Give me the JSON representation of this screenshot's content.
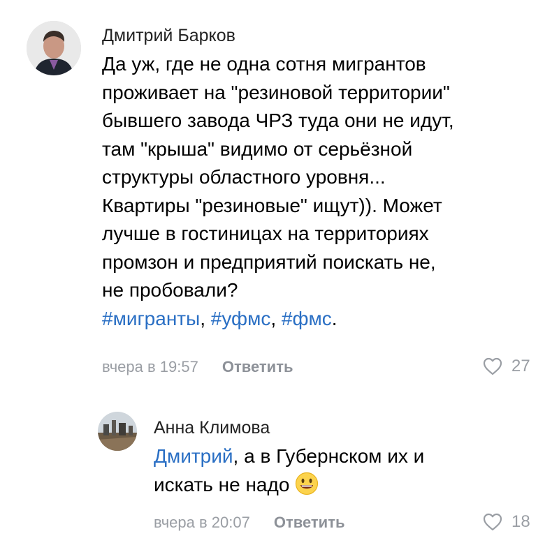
{
  "comments": [
    {
      "author": "Дмитрий Барков",
      "lines": [
        "Да уж, где не одна сотня мигрантов",
        "проживает на \"резиновой территории\"",
        "бывшего завода ЧРЗ туда они не идут,",
        "там \"крыша\" видимо от серьёзной",
        "структуры областного уровня...",
        "Квартиры \"резиновые\" ищут)). Может",
        "лучше в гостиницах на территориях",
        "промзон и предприятий поискать не,",
        "не пробовали?"
      ],
      "tags": [
        "#мигранты",
        "#уфмс",
        "#фмс"
      ],
      "tag_separator": ", ",
      "tag_end": ".",
      "time": "вчера в 19:57",
      "reply_label": "Ответить",
      "likes": "27"
    },
    {
      "author": "Анна Климова",
      "mention": "Дмитрий",
      "line1_rest": ", а в Губернском их и",
      "line2": "искать не надо",
      "emoji": "smiling-face",
      "time": "вчера в 20:07",
      "reply_label": "Ответить",
      "likes": "18"
    }
  ],
  "colors": {
    "link": "#2a6fc4",
    "meta": "#9a9ea4",
    "text": "#000000"
  }
}
